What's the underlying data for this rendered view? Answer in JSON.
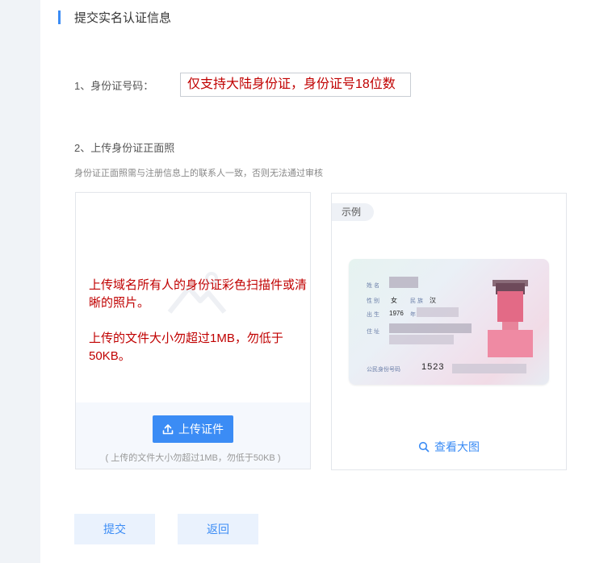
{
  "section": {
    "title": "提交实名认证信息"
  },
  "id_number_field": {
    "label": "1、身份证号码：",
    "value": "仅支持大陆身份证，身份证号18位数"
  },
  "upload_section": {
    "label": "2、上传身份证正面照",
    "hint": "身份证正面照需与注册信息上的联系人一致，否则无法通过审核",
    "note_line1": "上传域名所有人的身份证彩色扫描件或清晰的照片。",
    "note_line2": "上传的文件大小勿超过1MB，勿低于50KB。",
    "upload_button_label": "上传证件",
    "upload_limit": "( 上传的文件大小勿超过1MB，勿低于50KB )"
  },
  "example": {
    "tag": "示例",
    "card": {
      "name_label": "姓 名",
      "gender_label": "性 别",
      "gender_value": "女",
      "ethnicity_label": "民 族",
      "ethnicity_value": "汉",
      "birth_label": "出 生",
      "birth_year": "1976",
      "birth_year_unit": "年",
      "address_label": "住 址",
      "id_label": "公民身份号码",
      "id_prefix": "1523"
    },
    "view_large_label": "查看大图"
  },
  "actions": {
    "submit_label": "提交",
    "back_label": "返回"
  },
  "colors": {
    "accent": "#3b8cf5",
    "warning_text": "#c00000",
    "background": "#f0f3f7"
  },
  "icons": {
    "upload": "upload-icon",
    "search": "search-icon",
    "placeholder": "image-placeholder-icon"
  }
}
